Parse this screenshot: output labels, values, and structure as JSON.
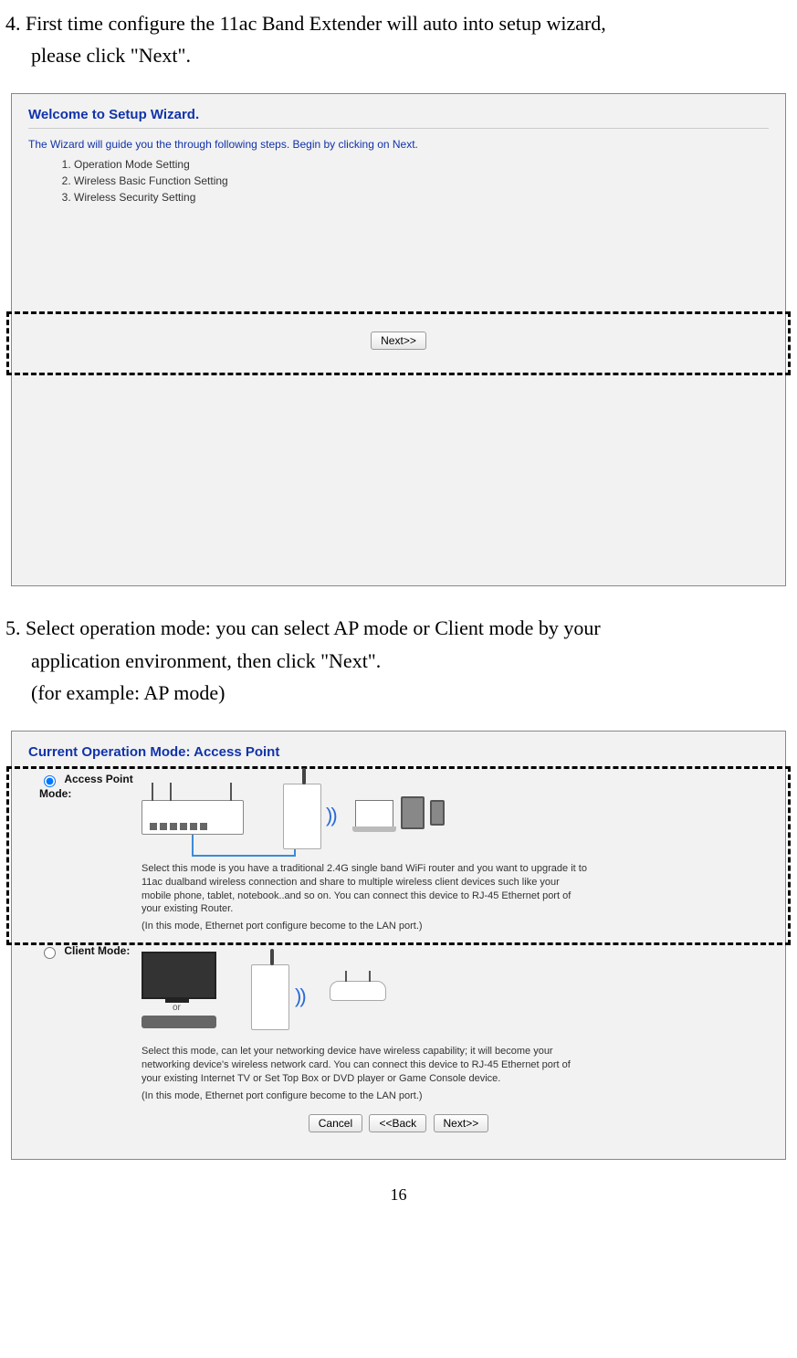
{
  "step4": {
    "text_first": "4. First time configure the 11ac Band Extender will auto into setup wizard,",
    "text_second": "please click \"Next\"."
  },
  "panel1": {
    "title": "Welcome to Setup Wizard.",
    "intro": "The Wizard will guide you the through following steps. Begin by clicking on Next.",
    "steps": {
      "s1": "Operation Mode Setting",
      "s2": "Wireless Basic Function Setting",
      "s3": "Wireless Security Setting"
    },
    "next_button": "Next>>"
  },
  "step5": {
    "line1": "5. Select operation mode: you can select AP mode or Client mode by your",
    "line2": "application environment, then click \"Next\".",
    "line3": "(for example: AP mode)"
  },
  "panel2": {
    "title": "Current Operation Mode: Access Point",
    "ap": {
      "label1": "Access Point",
      "label2": "Mode:",
      "desc": "Select this mode is you have a traditional 2.4G single band WiFi router and you want to upgrade it to 11ac dualband wireless connection and share to multiple wireless client devices such like your mobile phone, tablet, notebook..and so on. You can connect this device to RJ-45 Ethernet port of your existing Router.",
      "desc2": "(In this mode, Ethernet port configure become to the LAN port.)"
    },
    "client": {
      "label": "Client Mode:",
      "or": "or",
      "desc": "Select this mode, can let your networking device have wireless capability; it will become your networking device's wireless network card. You can connect this device to RJ-45 Ethernet port of your existing Internet TV or Set Top Box or DVD player or Game Console device.",
      "desc2": "(In this mode, Ethernet port configure become to the LAN port.)"
    },
    "buttons": {
      "cancel": "Cancel",
      "back": "<<Back",
      "next": "Next>>"
    }
  },
  "page_number": "16"
}
